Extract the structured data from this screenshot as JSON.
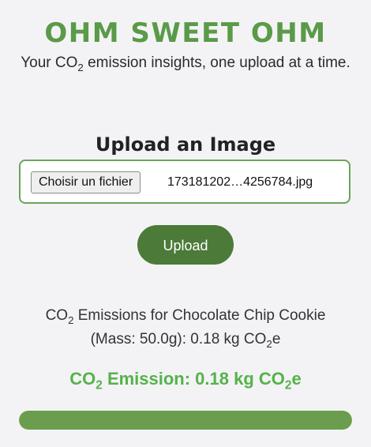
{
  "header": {
    "title": "OHM SWEET OHM",
    "tagline_html": "Your CO<sub>2</sub> emission insights, one upload at a time."
  },
  "upload": {
    "heading": "Upload an Image",
    "file_button_label": "Choisir un fichier",
    "file_name": "173181202…4256784.jpg",
    "submit_label": "Upload"
  },
  "result": {
    "description_html": "CO<sub>2</sub> Emissions for Chocolate Chip Cookie (Mass: 50.0g): 0.18 kg CO<sub>2</sub>e",
    "emission_html": "CO<sub>2</sub> Emission: 0.18 kg CO<sub>2</sub>e",
    "progress_fraction": 1.0
  },
  "colors": {
    "brand_green": "#5a9a48",
    "button_green": "#4c7a38",
    "emission_green": "#55b24a",
    "progress_green": "#6a9e4e"
  }
}
